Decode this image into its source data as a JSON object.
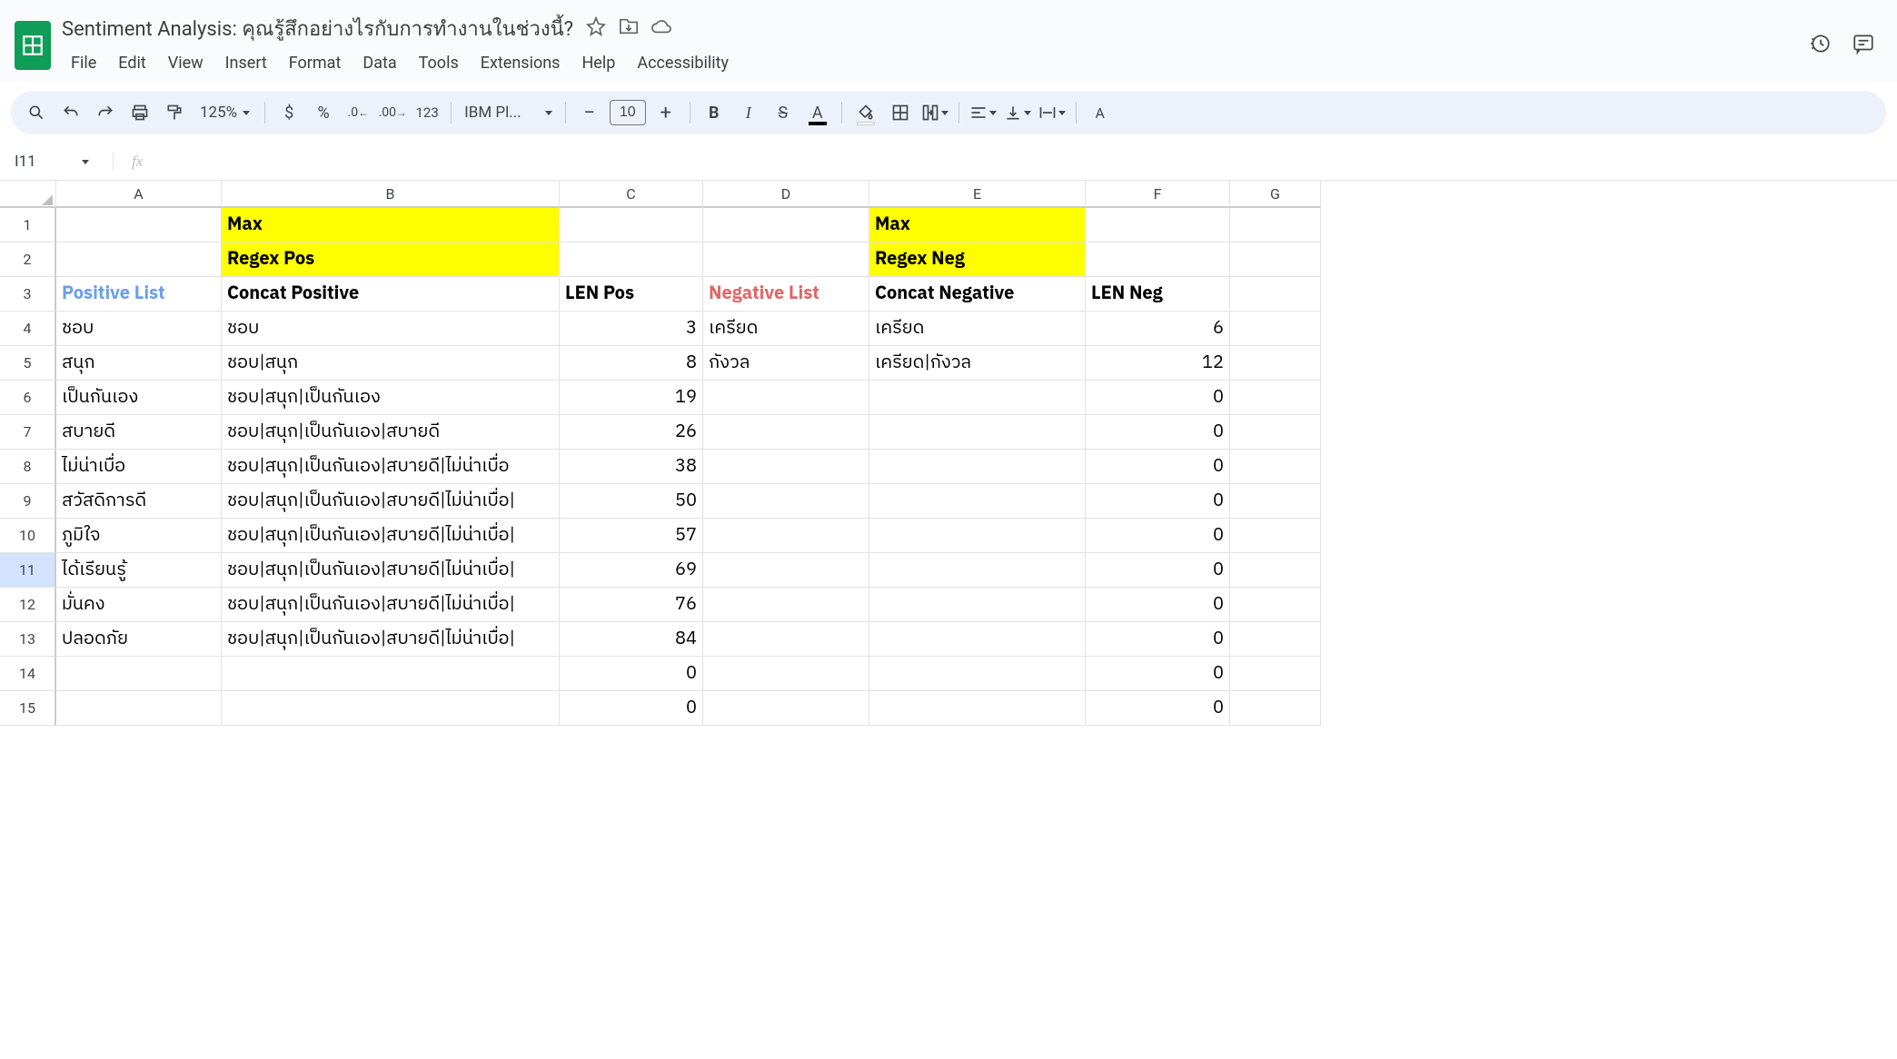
{
  "doc": {
    "title": "Sentiment Analysis: คุณรู้สึกอย่างไรกับการทำงานในช่วงนี้?"
  },
  "menus": [
    "File",
    "Edit",
    "View",
    "Insert",
    "Format",
    "Data",
    "Tools",
    "Extensions",
    "Help",
    "Accessibility"
  ],
  "toolbar": {
    "zoom": "125%",
    "font": "IBM Pl...",
    "fontsize": "10"
  },
  "namebox": "I11",
  "formula": "",
  "fx_placeholder": "fx",
  "columns": [
    "A",
    "B",
    "C",
    "D",
    "E",
    "F",
    "G"
  ],
  "rows": [
    {
      "n": "1",
      "cells": [
        "",
        "Max",
        "",
        "",
        "Max",
        "",
        ""
      ],
      "styles": [
        "",
        "yellow bold",
        "",
        "",
        "yellow bold",
        "",
        ""
      ]
    },
    {
      "n": "2",
      "cells": [
        "",
        "Regex Pos",
        "",
        "",
        "Regex Neg",
        "",
        ""
      ],
      "styles": [
        "",
        "yellow bold",
        "",
        "",
        "yellow bold",
        "",
        ""
      ]
    },
    {
      "n": "3",
      "cells": [
        "Positive List",
        "Concat Positive",
        "LEN Pos",
        "Negative List",
        "Concat Negative",
        "LEN Neg",
        ""
      ],
      "styles": [
        "bold blue-text",
        "bold",
        "bold",
        "bold red-text",
        "bold",
        "bold",
        ""
      ]
    },
    {
      "n": "4",
      "cells": [
        "ชอบ",
        "ชอบ",
        "3",
        "เครียด",
        "เครียด",
        "6",
        ""
      ]
    },
    {
      "n": "5",
      "cells": [
        "สนุก",
        "ชอบ|สนุก",
        "8",
        "กังวล",
        "เครียด|กังวล",
        "12",
        ""
      ]
    },
    {
      "n": "6",
      "cells": [
        "เป็นกันเอง",
        "ชอบ|สนุก|เป็นกันเอง",
        "19",
        "",
        "",
        "0",
        ""
      ]
    },
    {
      "n": "7",
      "cells": [
        "สบายดี",
        "ชอบ|สนุก|เป็นกันเอง|สบายดี",
        "26",
        "",
        "",
        "0",
        ""
      ]
    },
    {
      "n": "8",
      "cells": [
        "ไม่น่าเบื่อ",
        "ชอบ|สนุก|เป็นกันเอง|สบายดี|ไม่น่าเบื่อ",
        "38",
        "",
        "",
        "0",
        ""
      ]
    },
    {
      "n": "9",
      "cells": [
        "สวัสดิการดี",
        "ชอบ|สนุก|เป็นกันเอง|สบายดี|ไม่น่าเบื่อ|",
        "50",
        "",
        "",
        "0",
        ""
      ]
    },
    {
      "n": "10",
      "cells": [
        "ภูมิใจ",
        "ชอบ|สนุก|เป็นกันเอง|สบายดี|ไม่น่าเบื่อ|",
        "57",
        "",
        "",
        "0",
        ""
      ]
    },
    {
      "n": "11",
      "cells": [
        "ได้เรียนรู้",
        "ชอบ|สนุก|เป็นกันเอง|สบายดี|ไม่น่าเบื่อ|",
        "69",
        "",
        "",
        "0",
        ""
      ],
      "selected": true
    },
    {
      "n": "12",
      "cells": [
        "มั่นคง",
        "ชอบ|สนุก|เป็นกันเอง|สบายดี|ไม่น่าเบื่อ|",
        "76",
        "",
        "",
        "0",
        ""
      ]
    },
    {
      "n": "13",
      "cells": [
        "ปลอดภัย",
        "ชอบ|สนุก|เป็นกันเอง|สบายดี|ไม่น่าเบื่อ|",
        "84",
        "",
        "",
        "0",
        ""
      ]
    },
    {
      "n": "14",
      "cells": [
        "",
        "",
        "0",
        "",
        "",
        "0",
        ""
      ]
    },
    {
      "n": "15",
      "cells": [
        "",
        "",
        "0",
        "",
        "",
        "0",
        ""
      ]
    }
  ]
}
